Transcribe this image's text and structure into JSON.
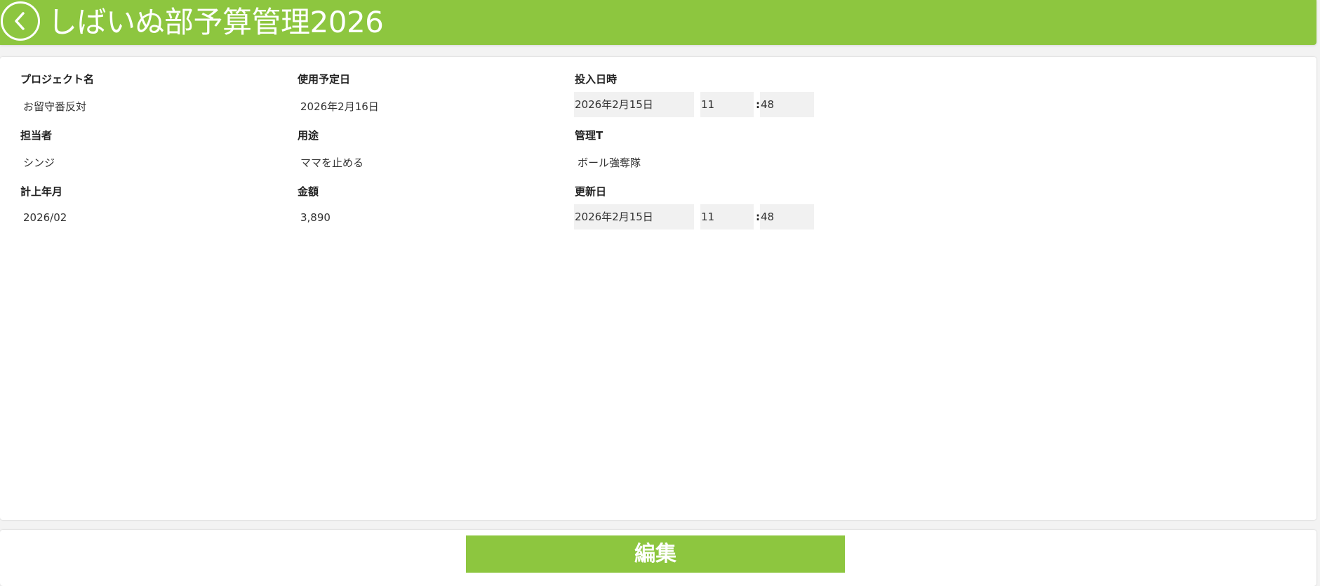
{
  "colors": {
    "accent": "#8dc63f",
    "header_text": "#ffffff",
    "input_background": "#f1f1f1"
  },
  "header": {
    "back_icon": "chevron-left-circle-icon",
    "title": "しばいぬ部予算管理2026"
  },
  "fields": {
    "project_name": {
      "label": "プロジェクト名",
      "value": "お留守番反対"
    },
    "planned_use_date": {
      "label": "使用予定日",
      "value": "2026年2月16日"
    },
    "submitted_datetime": {
      "label": "投入日時",
      "date": "2026年2月15日",
      "hour": "11",
      "minute": "48",
      "separator": ":"
    },
    "owner": {
      "label": "担当者",
      "value": "シンジ"
    },
    "purpose": {
      "label": "用途",
      "value": "ママを止める"
    },
    "admin_team": {
      "label": "管理T",
      "value": "ボール強奪隊"
    },
    "booking_month": {
      "label": "計上年月",
      "value": "2026/02"
    },
    "amount": {
      "label": "金額",
      "value": "3,890"
    },
    "updated_date": {
      "label": "更新日",
      "date": "2026年2月15日",
      "hour": "11",
      "minute": "48",
      "separator": ":"
    }
  },
  "footer": {
    "edit_label": "編集"
  }
}
